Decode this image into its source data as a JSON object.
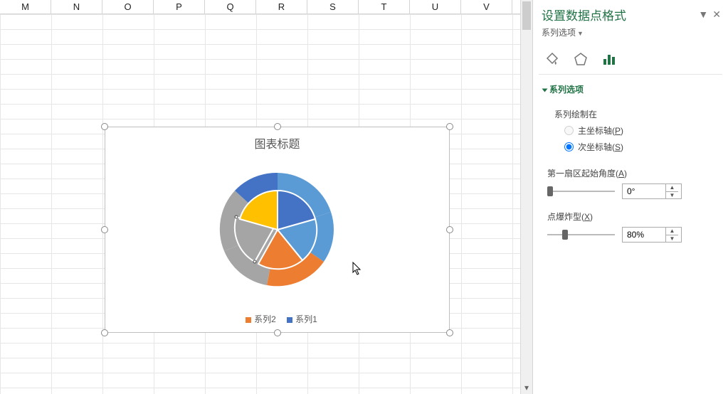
{
  "columns": [
    "M",
    "N",
    "O",
    "P",
    "Q",
    "R",
    "S",
    "T",
    "U",
    "V"
  ],
  "chart": {
    "title": "图表标题",
    "legend": [
      {
        "label": "系列2",
        "color": "#ED7D31"
      },
      {
        "label": "系列1",
        "color": "#4472C4"
      }
    ]
  },
  "chart_data": {
    "type": "pie",
    "title": "图表标题",
    "series": [
      {
        "name": "系列1",
        "values": [
          40,
          15,
          20,
          25
        ],
        "colors": [
          "#4472C4",
          "#ED7D31",
          "#A5A5A5",
          "#FFC000"
        ]
      },
      {
        "name": "系列2",
        "values": [
          40,
          15,
          20,
          25
        ],
        "colors": [
          "#5B9BD5",
          "#ED7D31",
          "#A5A5A5",
          "#FFC000"
        ]
      }
    ],
    "selected_point": {
      "series": "系列2",
      "index": 2
    },
    "explosion_pct": 80
  },
  "panel": {
    "title": "设置数据点格式",
    "subtitle": "系列选项",
    "section_title": "系列选项",
    "plot_on_label": "系列绘制在",
    "primary_axis_label": "主坐标轴(P)",
    "secondary_axis_label": "次坐标轴(S)",
    "axis_selected": "secondary",
    "angle_label": "第一扇区起始角度(A)",
    "angle_value": "0°",
    "angle_slider_pct": 0,
    "explosion_label": "点爆炸型(X)",
    "explosion_value": "80%",
    "explosion_slider_pct": 22
  }
}
